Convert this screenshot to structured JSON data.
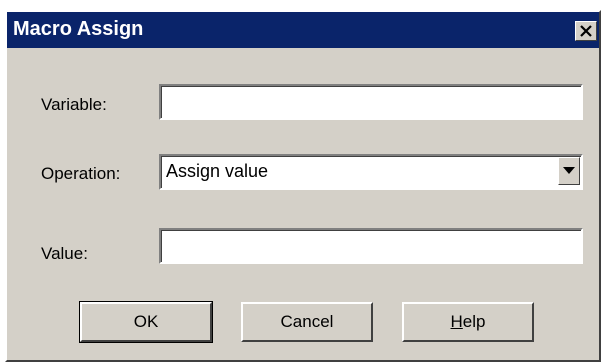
{
  "window": {
    "title": "Macro Assign",
    "close_icon": "close-icon"
  },
  "form": {
    "variable_label": "Variable:",
    "variable_value": "",
    "operation_label": "Operation:",
    "operation_value": "Assign value",
    "value_label": "Value:",
    "value_value": ""
  },
  "buttons": {
    "ok": "OK",
    "cancel": "Cancel",
    "help_first": "H",
    "help_rest": "elp"
  },
  "colors": {
    "titlebar": "#0a246a",
    "face": "#d4d0c8"
  }
}
